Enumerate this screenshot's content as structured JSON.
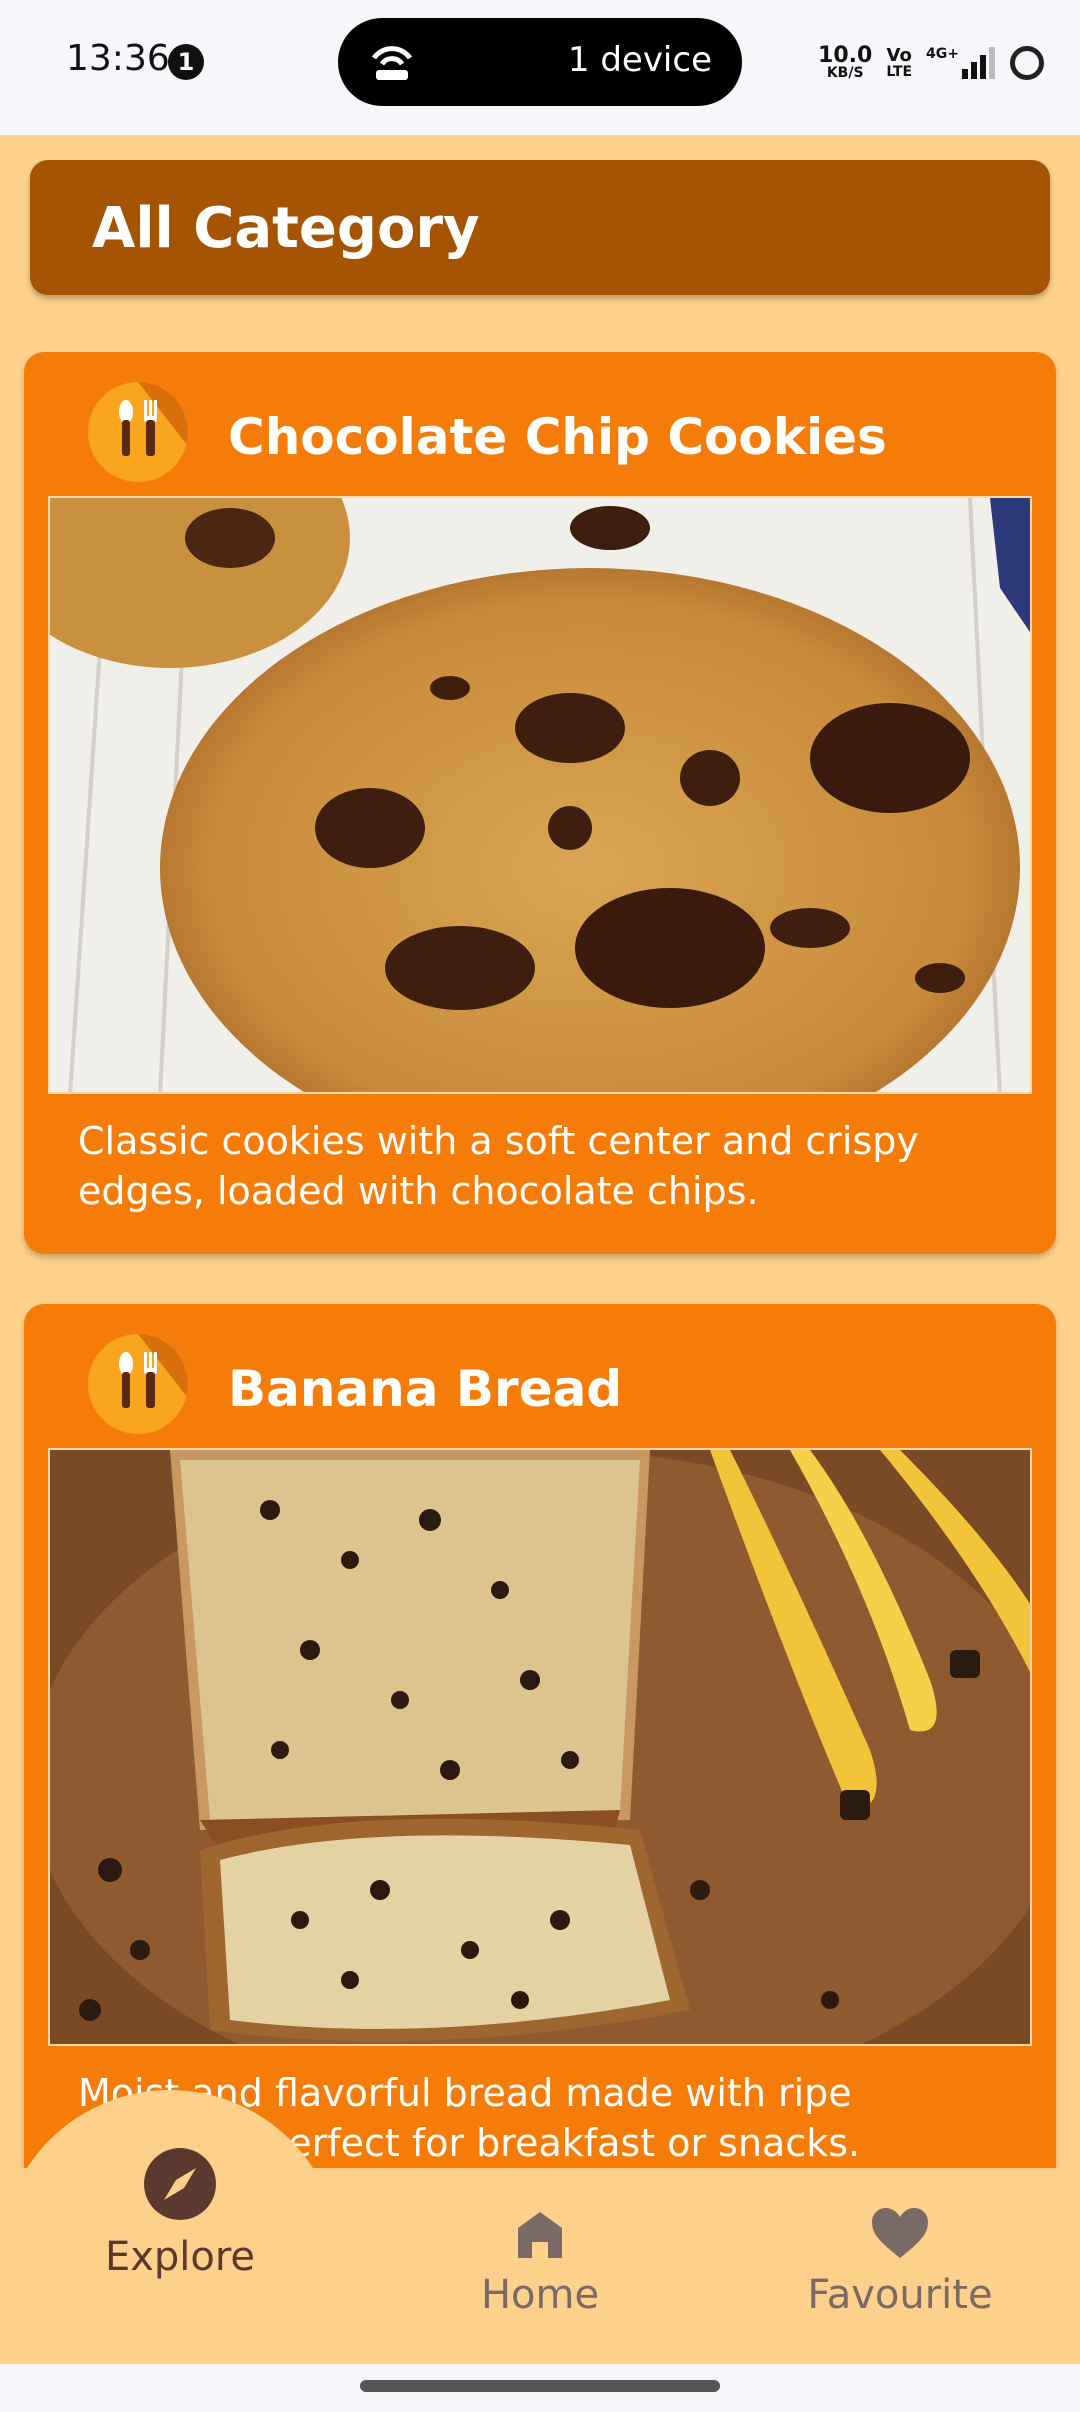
{
  "status_bar": {
    "time": "13:36",
    "notification_count": "1",
    "hotspot_text": "1 device",
    "net_speed_value": "10.0",
    "net_speed_unit": "KB/S",
    "volte_top": "Vo",
    "volte_bottom": "LTE",
    "network": "4G+"
  },
  "header": {
    "title": "All Category"
  },
  "recipes": [
    {
      "title": "Chocolate Chip Cookies",
      "description": "Classic cookies with a soft center and crispy edges, loaded with chocolate chips.",
      "icon": "utensils-icon"
    },
    {
      "title": "Banana Bread",
      "description": "Moist and flavorful bread made with ripe bananas, perfect for breakfast or snacks.",
      "icon": "utensils-icon"
    }
  ],
  "bottom_nav": {
    "items": [
      {
        "label": "Explore",
        "icon": "compass-icon",
        "active": true
      },
      {
        "label": "Home",
        "icon": "home-icon",
        "active": false
      },
      {
        "label": "Favourite",
        "icon": "heart-icon",
        "active": false
      }
    ]
  },
  "colors": {
    "background": "#fdd18b",
    "header": "#a55404",
    "card": "#f57c08",
    "nav_active": "#5a3a2e",
    "nav_inactive": "#7a6a66"
  }
}
